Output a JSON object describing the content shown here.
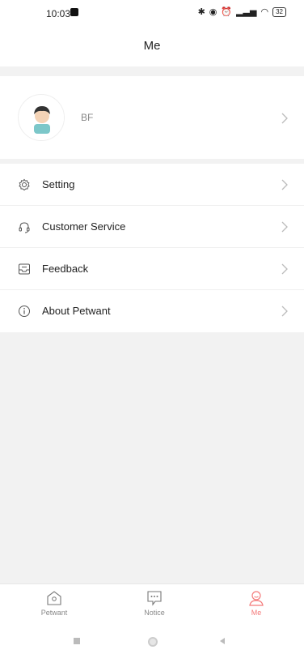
{
  "status": {
    "time": "10:03",
    "battery": "32"
  },
  "header": {
    "title": "Me"
  },
  "profile": {
    "name": "BF"
  },
  "menu": [
    {
      "label": "Setting",
      "icon": "gear-icon"
    },
    {
      "label": "Customer Service",
      "icon": "headset-icon"
    },
    {
      "label": "Feedback",
      "icon": "feedback-icon"
    },
    {
      "label": "About Petwant",
      "icon": "info-icon"
    }
  ],
  "tabs": [
    {
      "label": "Petwant",
      "icon": "home-icon",
      "active": false
    },
    {
      "label": "Notice",
      "icon": "message-icon",
      "active": false
    },
    {
      "label": "Me",
      "icon": "person-icon",
      "active": true
    }
  ],
  "colors": {
    "accent": "#f47b7b",
    "background": "#f2f2f2"
  }
}
